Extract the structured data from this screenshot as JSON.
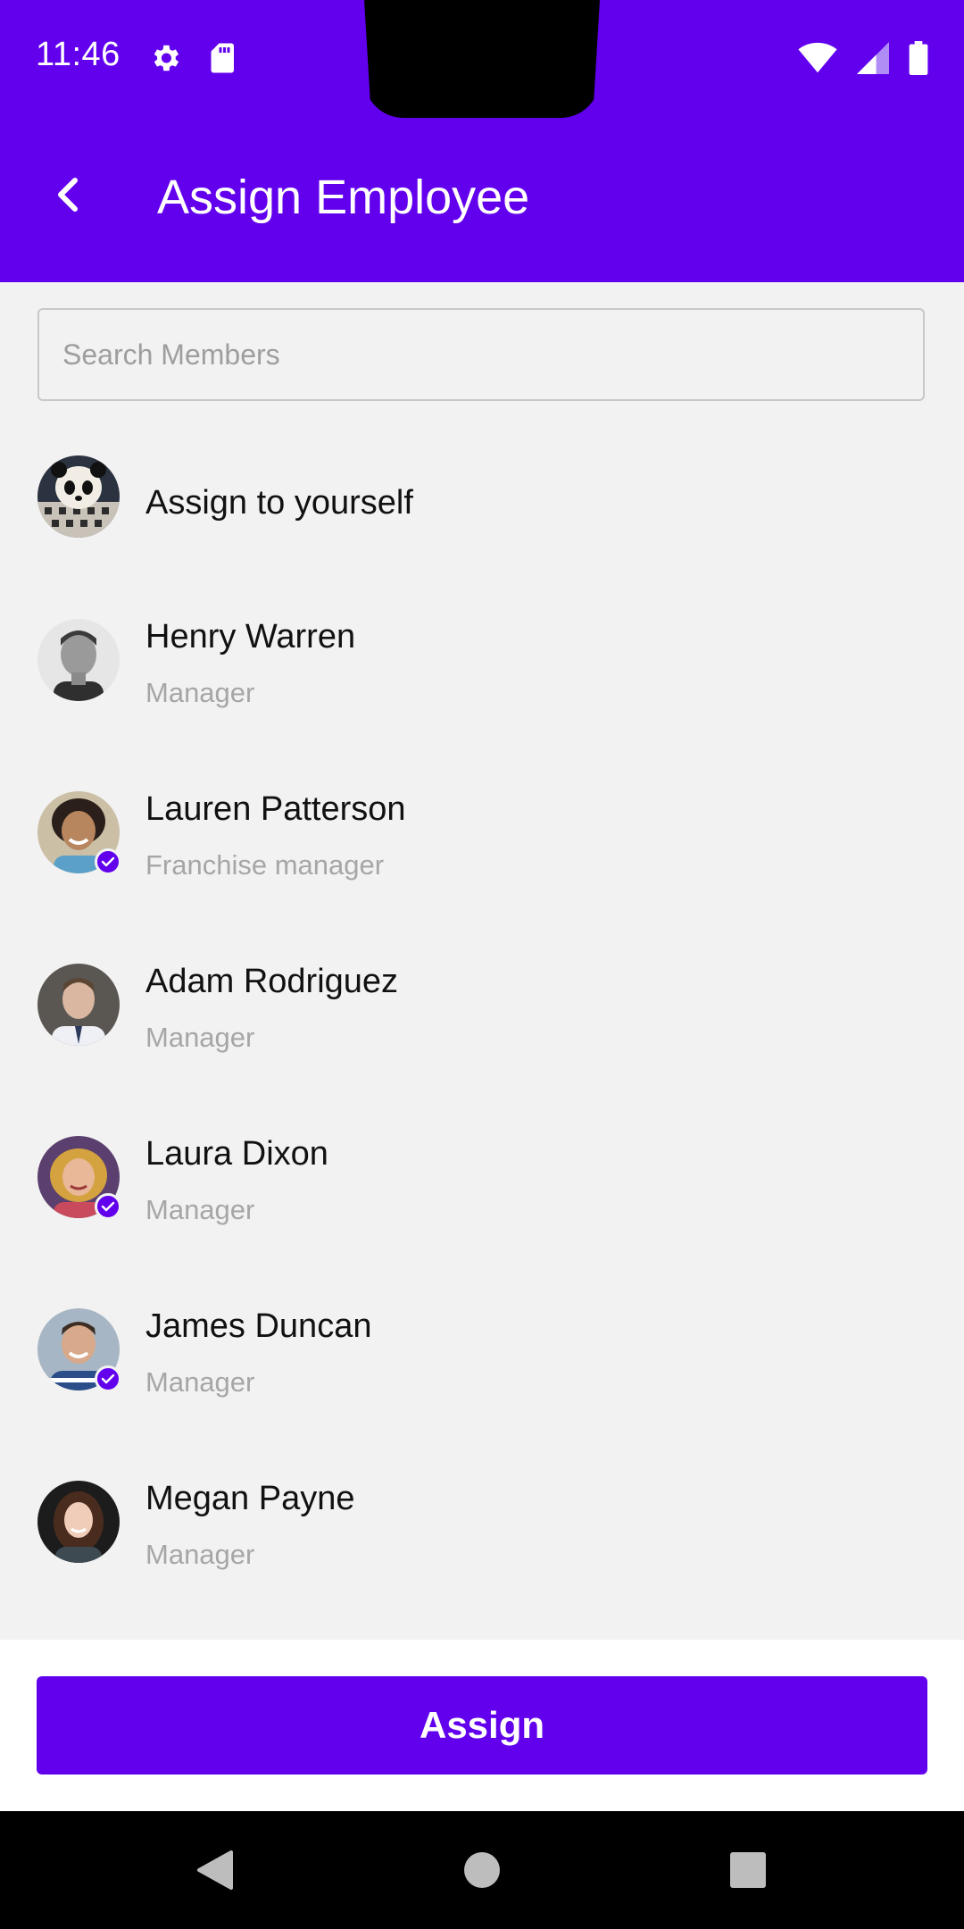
{
  "status_bar": {
    "time": "11:46",
    "left_icons": [
      "settings-icon",
      "sd-card-icon"
    ],
    "right_icons": [
      "wifi-icon",
      "cell-signal-icon",
      "battery-icon"
    ]
  },
  "app_bar": {
    "title": "Assign Employee",
    "back_icon": "chevron-left-icon",
    "color": "#6200ee"
  },
  "search": {
    "placeholder": "Search Members",
    "value": ""
  },
  "members": [
    {
      "name": "Assign to yourself",
      "role": "",
      "selected": false
    },
    {
      "name": "Henry Warren",
      "role": "Manager",
      "selected": false
    },
    {
      "name": "Lauren Patterson",
      "role": "Franchise manager",
      "selected": true
    },
    {
      "name": "Adam Rodriguez",
      "role": "Manager",
      "selected": false
    },
    {
      "name": "Laura Dixon",
      "role": "Manager",
      "selected": true
    },
    {
      "name": "James Duncan",
      "role": "Manager",
      "selected": true
    },
    {
      "name": "Megan Payne",
      "role": "Manager",
      "selected": false
    }
  ],
  "assign_button": {
    "label": "Assign"
  },
  "nav_bar": {
    "icons": [
      "back-triangle-icon",
      "home-circle-icon",
      "recents-square-icon"
    ]
  },
  "colors": {
    "accent": "#6200ee",
    "background": "#f2f2f2",
    "secondary_text": "#a6a6a6"
  }
}
